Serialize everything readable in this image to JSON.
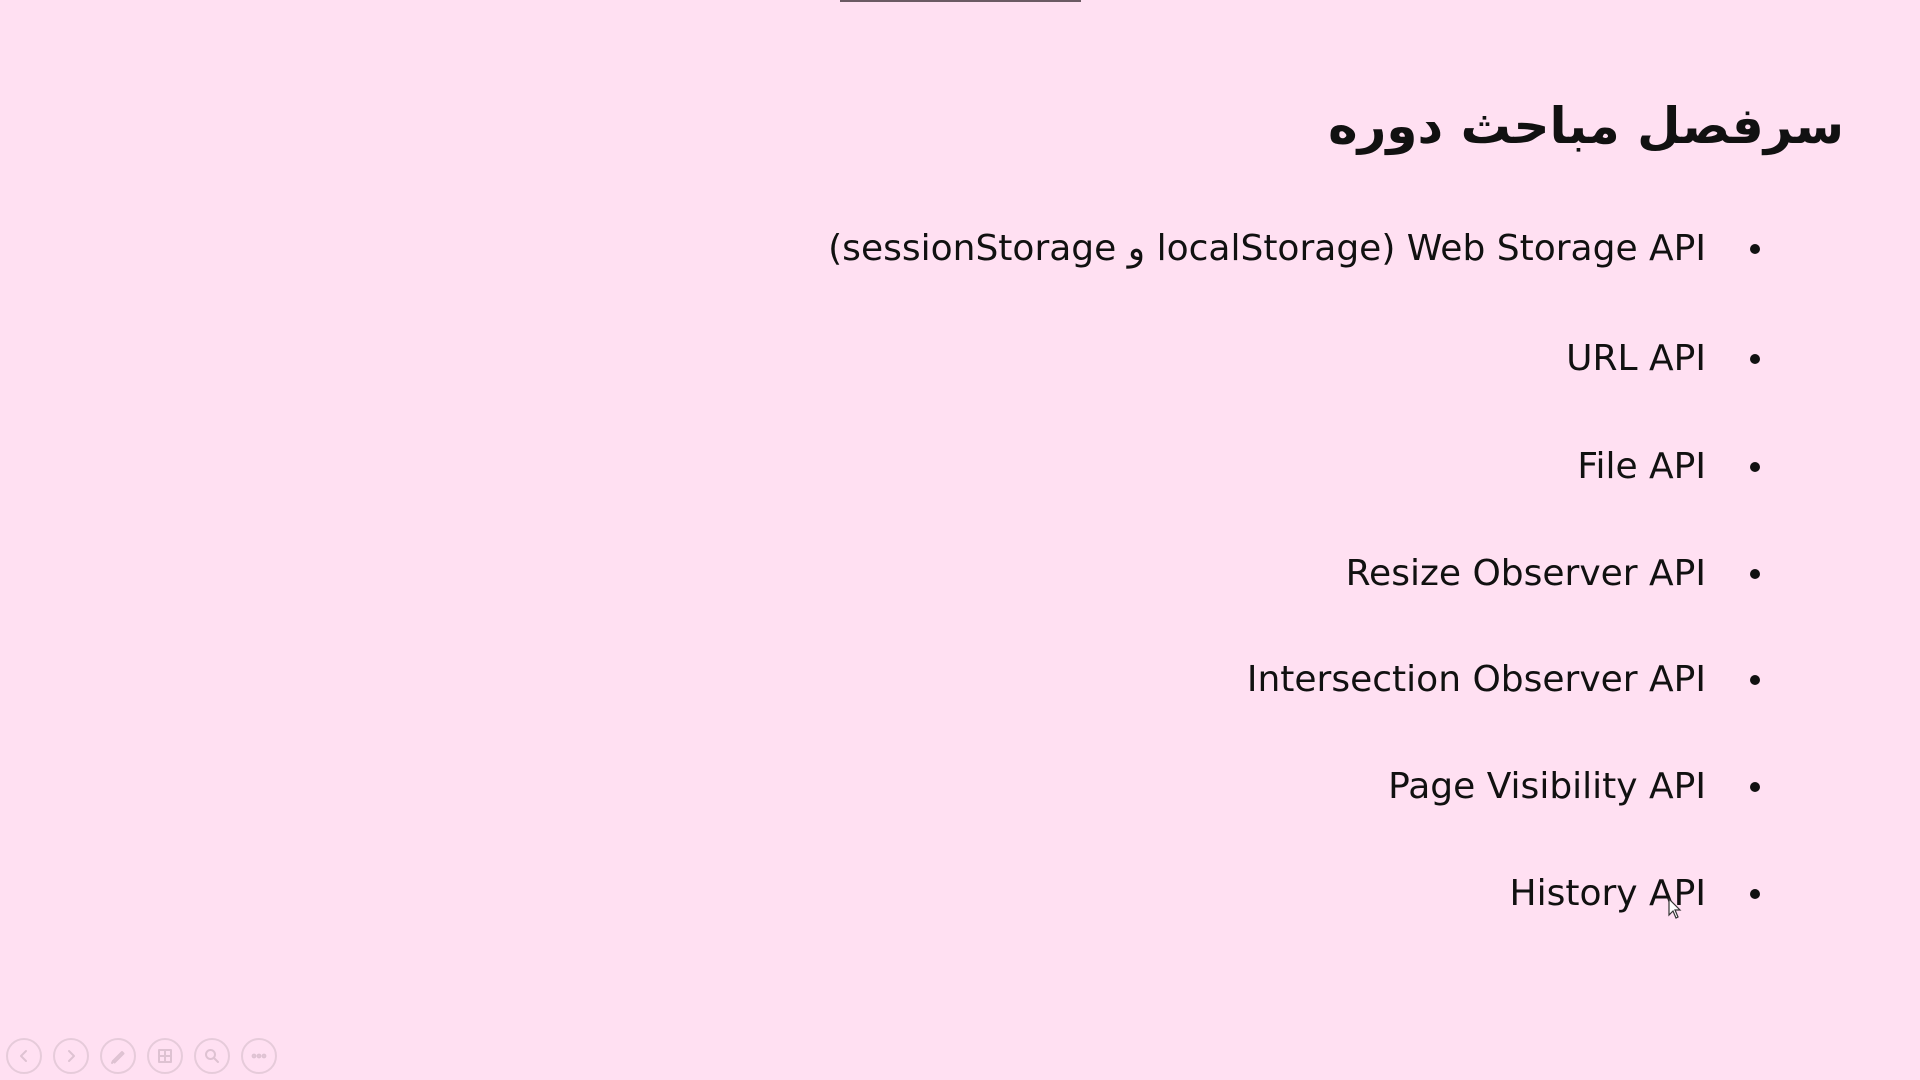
{
  "slide": {
    "title": "سرفصل مباحث دوره",
    "items": [
      {
        "label": "(sessionStorage و localStorage) Web Storage API"
      },
      {
        "label": "URL API"
      },
      {
        "label": "File API"
      },
      {
        "label": "Resize Observer API"
      },
      {
        "label": "Intersection Observer API"
      },
      {
        "label": "Page Visibility API"
      },
      {
        "label": "History API"
      }
    ]
  },
  "toolbar": {
    "icons": [
      "previous-slide-icon",
      "next-slide-icon",
      "pen-icon",
      "slides-grid-icon",
      "zoom-icon",
      "more-options-icon"
    ]
  },
  "colors": {
    "background": "#FFE0F2",
    "text": "#111111"
  }
}
